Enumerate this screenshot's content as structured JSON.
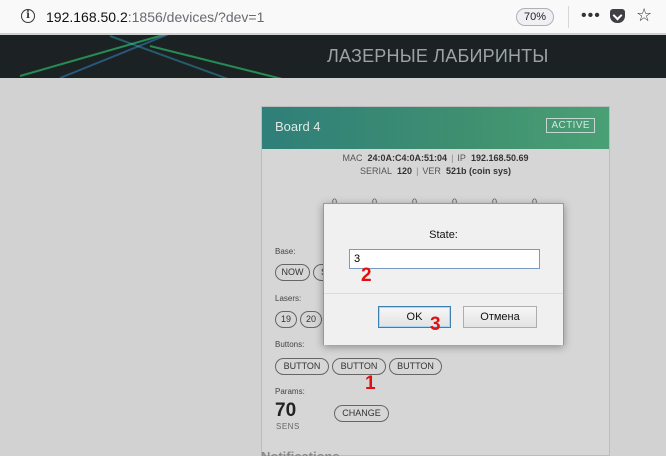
{
  "browser": {
    "url_host": "192.168.50.2",
    "url_rest": ":1856/devices/?dev=1",
    "zoom": "70%"
  },
  "site": {
    "title": "ЛАЗЕРНЫЕ ЛАБИРИНТЫ"
  },
  "card": {
    "title": "Board 4",
    "status": "ACTIVE",
    "meta": {
      "mac_label": "MAC",
      "mac": "24:0A:C4:0A:51:04",
      "ip_label": "IP",
      "ip": "192.168.50.69",
      "serial_label": "SERIAL",
      "serial": "120",
      "ver_label": "VER",
      "ver": "521b (coin sys)"
    },
    "zeros": [
      "0",
      "0",
      "0",
      "0",
      "0",
      "0"
    ],
    "base": {
      "label": "Base:",
      "buttons": [
        "NOW",
        "S"
      ]
    },
    "lasers": {
      "label": "Lasers:",
      "buttons": [
        "19",
        "20"
      ]
    },
    "buttons_section": {
      "label": "Buttons:",
      "buttons": [
        "BUTTON",
        "BUTTON",
        "BUTTON"
      ]
    },
    "params": {
      "label": "Params:",
      "value": "70",
      "unit": "SENS",
      "change_label": "CHANGE"
    },
    "bottom_text": "Notifications"
  },
  "dialog": {
    "label": "State:",
    "input_value": "3",
    "ok_label": "OK",
    "cancel_label": "Отмена"
  },
  "markers": [
    "1",
    "2",
    "3"
  ],
  "colors": {
    "card_header": "#3f9070",
    "marker": "#e01010"
  }
}
